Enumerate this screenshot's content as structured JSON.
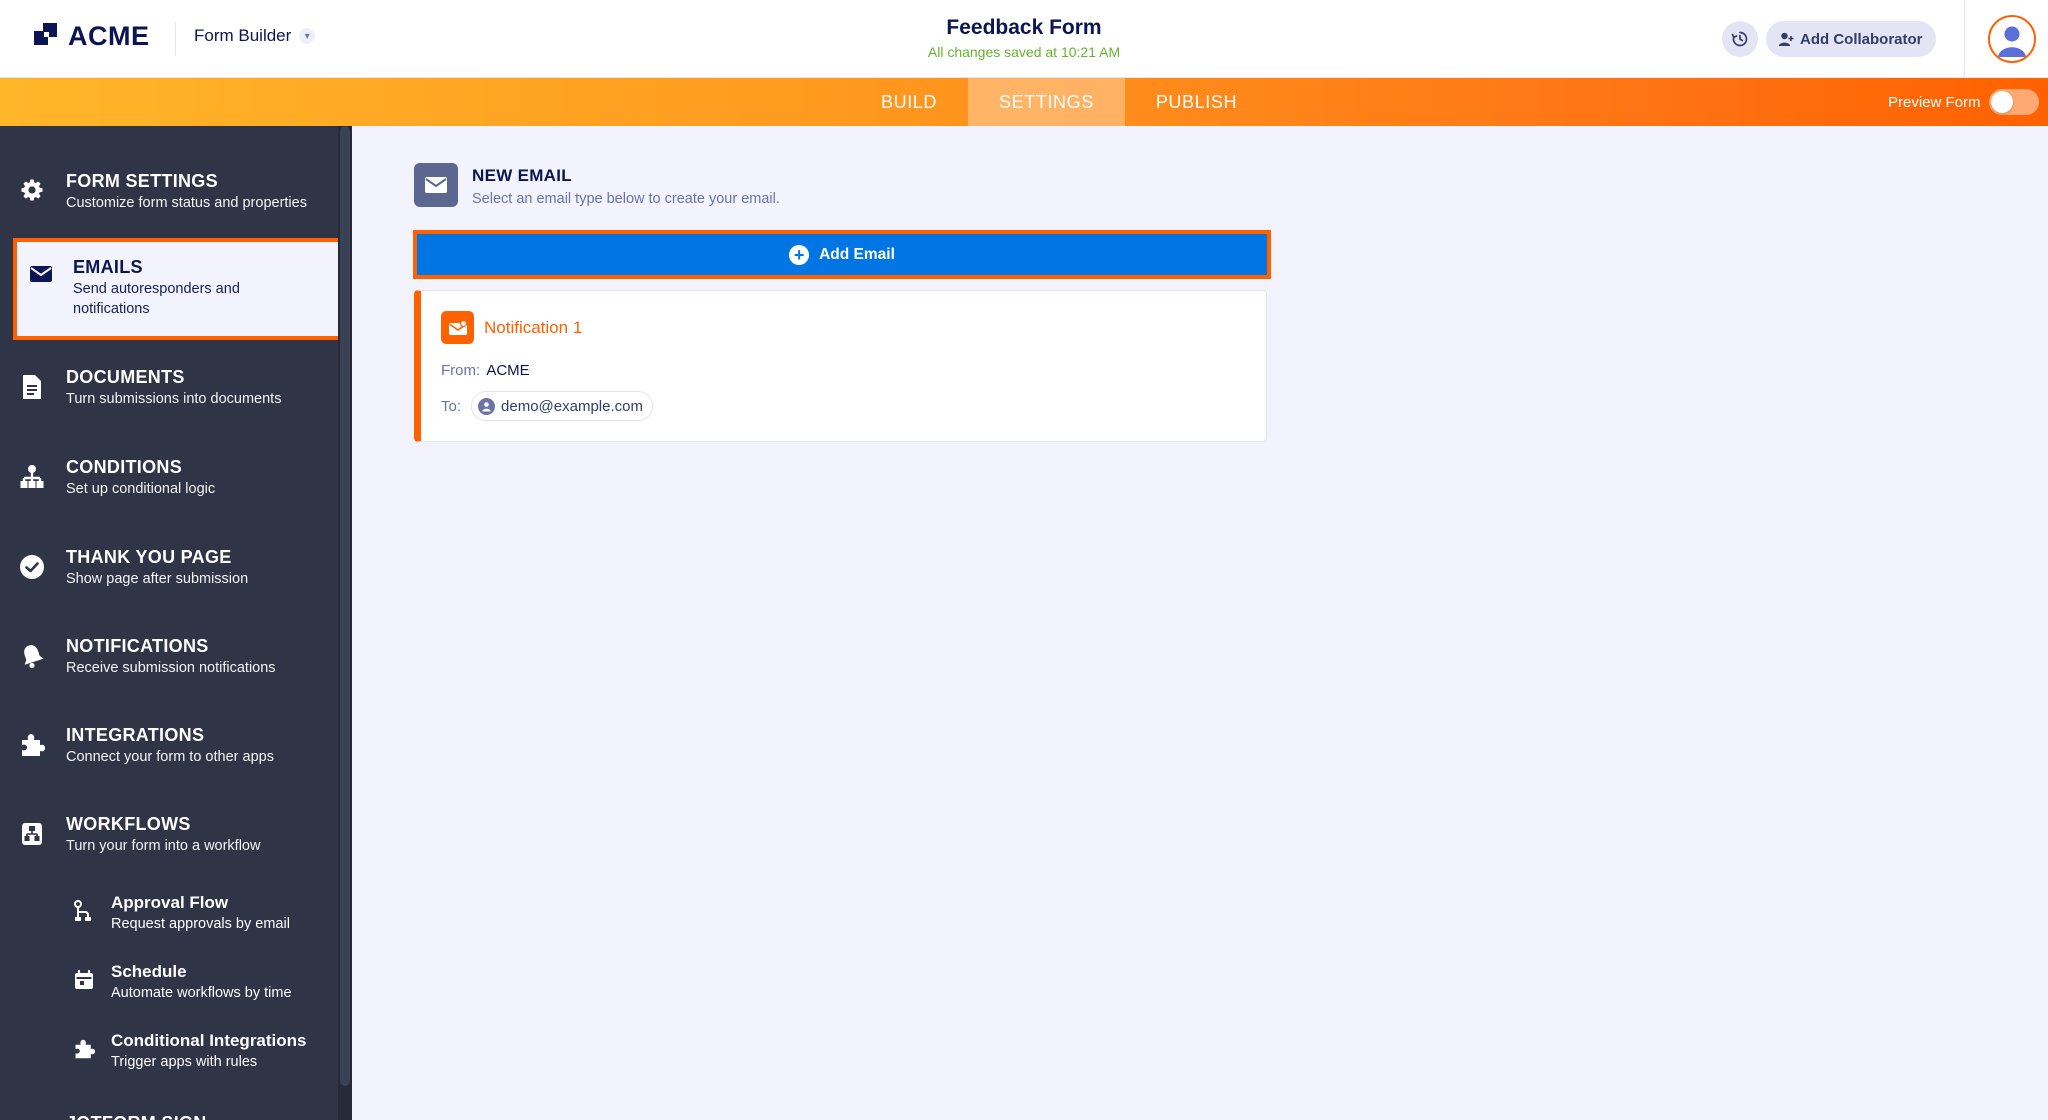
{
  "header": {
    "logo_text": "ACME",
    "builder_label": "Form Builder",
    "form_title": "Feedback Form",
    "saved_status": "All changes saved at 10:21 AM",
    "collaborator_label": "Add Collaborator"
  },
  "nav": {
    "tabs": [
      "BUILD",
      "SETTINGS",
      "PUBLISH"
    ],
    "active_tab": "SETTINGS",
    "preview_label": "Preview Form"
  },
  "sidebar": {
    "items": [
      {
        "title": "FORM SETTINGS",
        "subtitle": "Customize form status and properties",
        "icon": "gear-icon"
      },
      {
        "title": "EMAILS",
        "subtitle": "Send autoresponders and notifications",
        "icon": "envelope-icon"
      },
      {
        "title": "DOCUMENTS",
        "subtitle": "Turn submissions into documents",
        "icon": "document-icon"
      },
      {
        "title": "CONDITIONS",
        "subtitle": "Set up conditional logic",
        "icon": "hierarchy-icon"
      },
      {
        "title": "THANK YOU PAGE",
        "subtitle": "Show page after submission",
        "icon": "check-circle-icon"
      },
      {
        "title": "NOTIFICATIONS",
        "subtitle": "Receive submission notifications",
        "icon": "bell-icon"
      },
      {
        "title": "INTEGRATIONS",
        "subtitle": "Connect your form to other apps",
        "icon": "puzzle-icon"
      },
      {
        "title": "WORKFLOWS",
        "subtitle": "Turn your form into a workflow",
        "icon": "workflow-icon"
      }
    ],
    "selected": "EMAILS",
    "subitems": [
      {
        "title": "Approval Flow",
        "subtitle": "Request approvals by email",
        "icon": "approval-flow-icon"
      },
      {
        "title": "Schedule",
        "subtitle": "Automate workflows by time",
        "icon": "calendar-icon"
      },
      {
        "title": "Conditional Integrations",
        "subtitle": "Trigger apps with rules",
        "icon": "puzzle-icon"
      }
    ],
    "partial_item": "JOTFORM SIGN"
  },
  "main": {
    "title": "NEW EMAIL",
    "subtitle": "Select an email type below to create your email.",
    "add_button": "Add Email",
    "card": {
      "title": "Notification 1",
      "from_label": "From:",
      "from_value": "ACME",
      "to_label": "To:",
      "to_value": "demo@example.com"
    }
  },
  "colors": {
    "brand_orange": "#ff6100",
    "primary_blue": "#0075e3",
    "sidebar_bg": "#2f3446",
    "navy": "#0a1551",
    "saved_green": "#66b32e"
  }
}
